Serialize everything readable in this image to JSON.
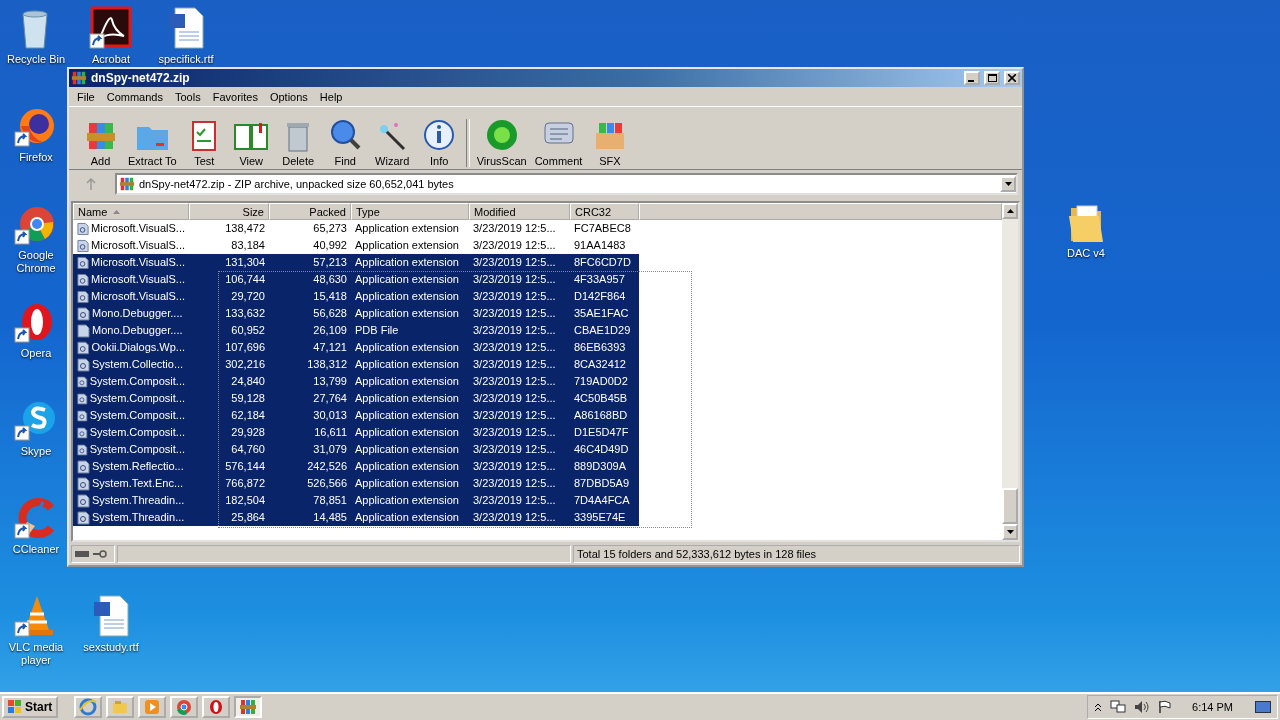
{
  "desktop_icons": [
    {
      "label": "Recycle Bin",
      "kind": "recycle",
      "shortcut": false
    },
    {
      "label": "Acrobat",
      "kind": "acrobat",
      "shortcut": true
    },
    {
      "label": "specifick.rtf",
      "kind": "word",
      "shortcut": false
    },
    {
      "label": "Firefox",
      "kind": "firefox",
      "shortcut": true
    },
    {
      "label": "Google Chrome",
      "kind": "chrome",
      "shortcut": true
    },
    {
      "label": "Opera",
      "kind": "opera",
      "shortcut": true
    },
    {
      "label": "Skype",
      "kind": "skype",
      "shortcut": true
    },
    {
      "label": "CCleaner",
      "kind": "ccleaner",
      "shortcut": true
    },
    {
      "label": "VLC media player",
      "kind": "vlc",
      "shortcut": true
    },
    {
      "label": "sexstudy.rtf",
      "kind": "word",
      "shortcut": false
    },
    {
      "label": "DAC v4",
      "kind": "folder",
      "shortcut": false
    }
  ],
  "window": {
    "title": "dnSpy-net472.zip",
    "menu": [
      "File",
      "Commands",
      "Tools",
      "Favorites",
      "Options",
      "Help"
    ],
    "toolbar": [
      {
        "label": "Add",
        "kind": "add"
      },
      {
        "label": "Extract To",
        "kind": "extract"
      },
      {
        "label": "Test",
        "kind": "test"
      },
      {
        "label": "View",
        "kind": "view"
      },
      {
        "label": "Delete",
        "kind": "delete"
      },
      {
        "label": "Find",
        "kind": "find"
      },
      {
        "label": "Wizard",
        "kind": "wizard"
      },
      {
        "label": "Info",
        "kind": "info"
      },
      {
        "label": "VirusScan",
        "kind": "virus"
      },
      {
        "label": "Comment",
        "kind": "comment"
      },
      {
        "label": "SFX",
        "kind": "sfx"
      }
    ],
    "address": "dnSpy-net472.zip - ZIP archive, unpacked size 60,652,041 bytes",
    "columns": [
      {
        "label": "Name",
        "sorted": true
      },
      {
        "label": "Size",
        "sorted": false
      },
      {
        "label": "Packed",
        "sorted": false
      },
      {
        "label": "Type",
        "sorted": false
      },
      {
        "label": "Modified",
        "sorted": false
      },
      {
        "label": "CRC32",
        "sorted": false
      }
    ],
    "rows": [
      {
        "name": "Microsoft.VisualS...",
        "size": "138,472",
        "packed": "65,273",
        "type": "Application extension",
        "modified": "3/23/2019 12:5...",
        "crc": "FC7ABEC8",
        "kind": "dll",
        "selected": false
      },
      {
        "name": "Microsoft.VisualS...",
        "size": "83,184",
        "packed": "40,992",
        "type": "Application extension",
        "modified": "3/23/2019 12:5...",
        "crc": "91AA1483",
        "kind": "dll",
        "selected": false
      },
      {
        "name": "Microsoft.VisualS...",
        "size": "131,304",
        "packed": "57,213",
        "type": "Application extension",
        "modified": "3/23/2019 12:5...",
        "crc": "8FC6CD7D",
        "kind": "dll",
        "selected": true
      },
      {
        "name": "Microsoft.VisualS...",
        "size": "106,744",
        "packed": "48,630",
        "type": "Application extension",
        "modified": "3/23/2019 12:5...",
        "crc": "4F33A957",
        "kind": "dll",
        "selected": true
      },
      {
        "name": "Microsoft.VisualS...",
        "size": "29,720",
        "packed": "15,418",
        "type": "Application extension",
        "modified": "3/23/2019 12:5...",
        "crc": "D142F864",
        "kind": "dll",
        "selected": true
      },
      {
        "name": "Mono.Debugger....",
        "size": "133,632",
        "packed": "56,628",
        "type": "Application extension",
        "modified": "3/23/2019 12:5...",
        "crc": "35AE1FAC",
        "kind": "dll",
        "selected": true
      },
      {
        "name": "Mono.Debugger....",
        "size": "60,952",
        "packed": "26,109",
        "type": "PDB File",
        "modified": "3/23/2019 12:5...",
        "crc": "CBAE1D29",
        "kind": "pdb",
        "selected": true
      },
      {
        "name": "Ookii.Dialogs.Wp...",
        "size": "107,696",
        "packed": "47,121",
        "type": "Application extension",
        "modified": "3/23/2019 12:5...",
        "crc": "86EB6393",
        "kind": "dll",
        "selected": true
      },
      {
        "name": "System.Collectio...",
        "size": "302,216",
        "packed": "138,312",
        "type": "Application extension",
        "modified": "3/23/2019 12:5...",
        "crc": "8CA32412",
        "kind": "dll",
        "selected": true
      },
      {
        "name": "System.Composit...",
        "size": "24,840",
        "packed": "13,799",
        "type": "Application extension",
        "modified": "3/23/2019 12:5...",
        "crc": "719AD0D2",
        "kind": "dll",
        "selected": true
      },
      {
        "name": "System.Composit...",
        "size": "59,128",
        "packed": "27,764",
        "type": "Application extension",
        "modified": "3/23/2019 12:5...",
        "crc": "4C50B45B",
        "kind": "dll",
        "selected": true
      },
      {
        "name": "System.Composit...",
        "size": "62,184",
        "packed": "30,013",
        "type": "Application extension",
        "modified": "3/23/2019 12:5...",
        "crc": "A86168BD",
        "kind": "dll",
        "selected": true
      },
      {
        "name": "System.Composit...",
        "size": "29,928",
        "packed": "16,611",
        "type": "Application extension",
        "modified": "3/23/2019 12:5...",
        "crc": "D1E5D47F",
        "kind": "dll",
        "selected": true
      },
      {
        "name": "System.Composit...",
        "size": "64,760",
        "packed": "31,079",
        "type": "Application extension",
        "modified": "3/23/2019 12:5...",
        "crc": "46C4D49D",
        "kind": "dll",
        "selected": true
      },
      {
        "name": "System.Reflectio...",
        "size": "576,144",
        "packed": "242,526",
        "type": "Application extension",
        "modified": "3/23/2019 12:5...",
        "crc": "889D309A",
        "kind": "dll",
        "selected": true
      },
      {
        "name": "System.Text.Enc...",
        "size": "766,872",
        "packed": "526,566",
        "type": "Application extension",
        "modified": "3/23/2019 12:5...",
        "crc": "87DBD5A9",
        "kind": "dll",
        "selected": true
      },
      {
        "name": "System.Threadin...",
        "size": "182,504",
        "packed": "78,851",
        "type": "Application extension",
        "modified": "3/23/2019 12:5...",
        "crc": "7D4A4FCA",
        "kind": "dll",
        "selected": true
      },
      {
        "name": "System.Threadin...",
        "size": "25,864",
        "packed": "14,485",
        "type": "Application extension",
        "modified": "3/23/2019 12:5...",
        "crc": "3395E74E",
        "kind": "dll",
        "selected": true
      }
    ],
    "status": "Total 15 folders and 52,333,612 bytes in 128 files"
  },
  "taskbar": {
    "start": "Start",
    "apps": [
      {
        "kind": "ie",
        "active": false
      },
      {
        "kind": "explorer",
        "active": false
      },
      {
        "kind": "media",
        "active": false
      },
      {
        "kind": "chrome",
        "active": false
      },
      {
        "kind": "opera",
        "active": false
      },
      {
        "kind": "winrar",
        "active": true
      }
    ],
    "clock": "6:14 PM"
  }
}
